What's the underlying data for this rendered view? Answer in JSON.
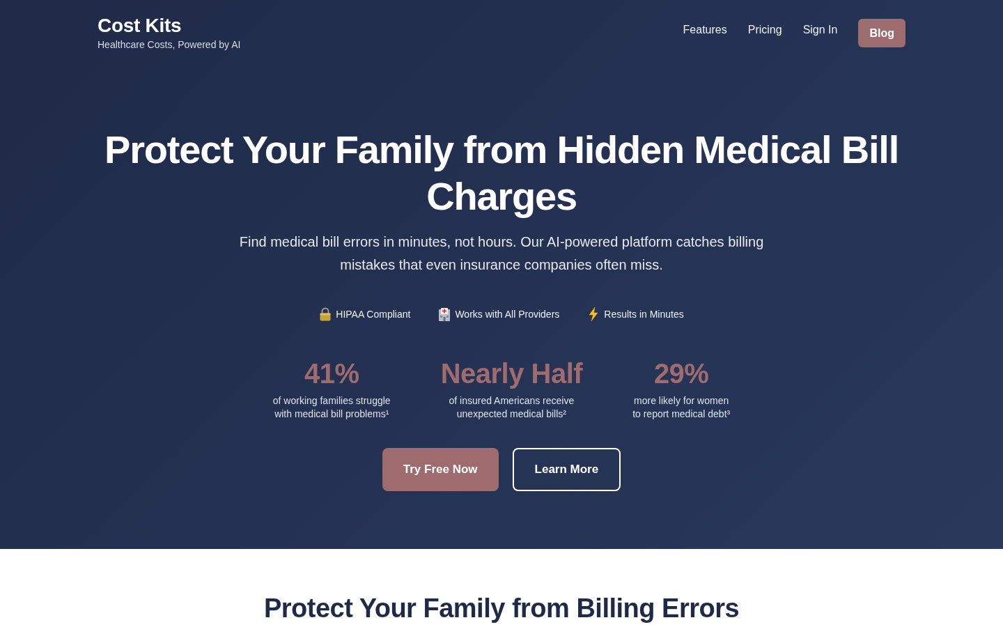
{
  "header": {
    "logo": "Cost Kits",
    "tagline": "Healthcare Costs, Powered by AI",
    "nav": [
      {
        "label": "Features",
        "kind": "link"
      },
      {
        "label": "Pricing",
        "kind": "link"
      },
      {
        "label": "Sign In",
        "kind": "link"
      },
      {
        "label": "Blog",
        "kind": "button"
      }
    ]
  },
  "hero": {
    "title": "Protect Your Family from Hidden Medical Bill Charges",
    "subtitle": "Find medical bill errors in minutes, not hours. Our AI-powered platform catches billing mistakes that even insurance companies often miss.",
    "badges": [
      {
        "kind": "lock",
        "label": "HIPAA Compliant"
      },
      {
        "kind": "hospital",
        "label": "Works with All Providers"
      },
      {
        "kind": "lightning",
        "label": "Results in Minutes"
      }
    ],
    "stats": [
      {
        "value": "41%",
        "description": "of working families struggle\nwith medical bill problems¹"
      },
      {
        "value": "Nearly Half",
        "description": "of insured Americans receive\nunexpected medical bills²"
      },
      {
        "value": "29%",
        "description": "more likely for women\nto report medical debt³"
      }
    ],
    "buttons": [
      {
        "label": "Try Free Now",
        "kind": "primary"
      },
      {
        "label": "Learn More",
        "kind": "outline"
      }
    ]
  },
  "section": {
    "title": "Protect Your Family from Billing Errors"
  }
}
